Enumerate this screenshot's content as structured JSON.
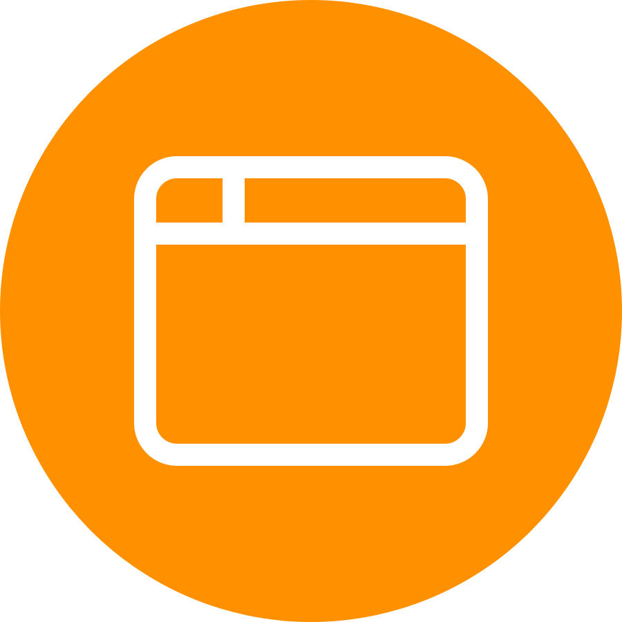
{
  "icon": {
    "name": "browser-window-icon",
    "background_color": "#FF9100",
    "foreground_color": "#FFFFFF"
  }
}
